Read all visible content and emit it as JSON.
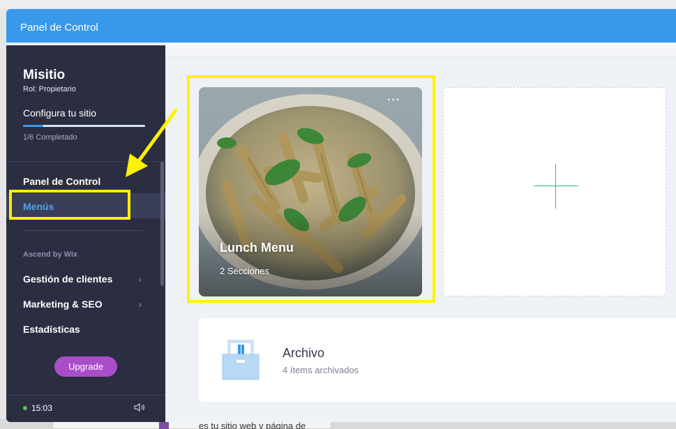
{
  "window": {
    "title": "Panel de Control"
  },
  "sidebar": {
    "site_name": "Misitio",
    "role": "Rol: Propietario",
    "setup_label": "Configura tu sitio",
    "progress": {
      "text": "1/6 Completado",
      "fraction": 0.1667
    },
    "items": [
      {
        "label": "Panel de Control",
        "active": false
      },
      {
        "label": "Menús",
        "active": true
      }
    ],
    "section_label": "Ascend by Wix",
    "section_items": [
      {
        "label": "Gestión de clientes",
        "chevron": "›"
      },
      {
        "label": "Marketing & SEO",
        "chevron": "›"
      },
      {
        "label": "Estadísticas"
      }
    ],
    "upgrade_label": "Upgrade",
    "status": {
      "time": "15:03",
      "color": "#60bc57"
    },
    "speaker_icon": "speaker-icon"
  },
  "main": {
    "menu_card": {
      "title": "Lunch Menu",
      "subtitle": "2 Secciones",
      "more_label": "···"
    },
    "add_card": {
      "icon": "plus-icon",
      "color": "#2eb58f"
    },
    "archive": {
      "title": "Archivo",
      "subtitle": "4 ítems archivados",
      "icon": "archive-box-icon"
    }
  },
  "background_page": {
    "snippet": "es tu sitio web y página de"
  },
  "colors": {
    "titlebar": "#3899ec",
    "sidebar": "#2b2d41",
    "active_nav": "#4ea3f1",
    "upgrade": "#aa4dc8",
    "annotation": "#fff200"
  }
}
